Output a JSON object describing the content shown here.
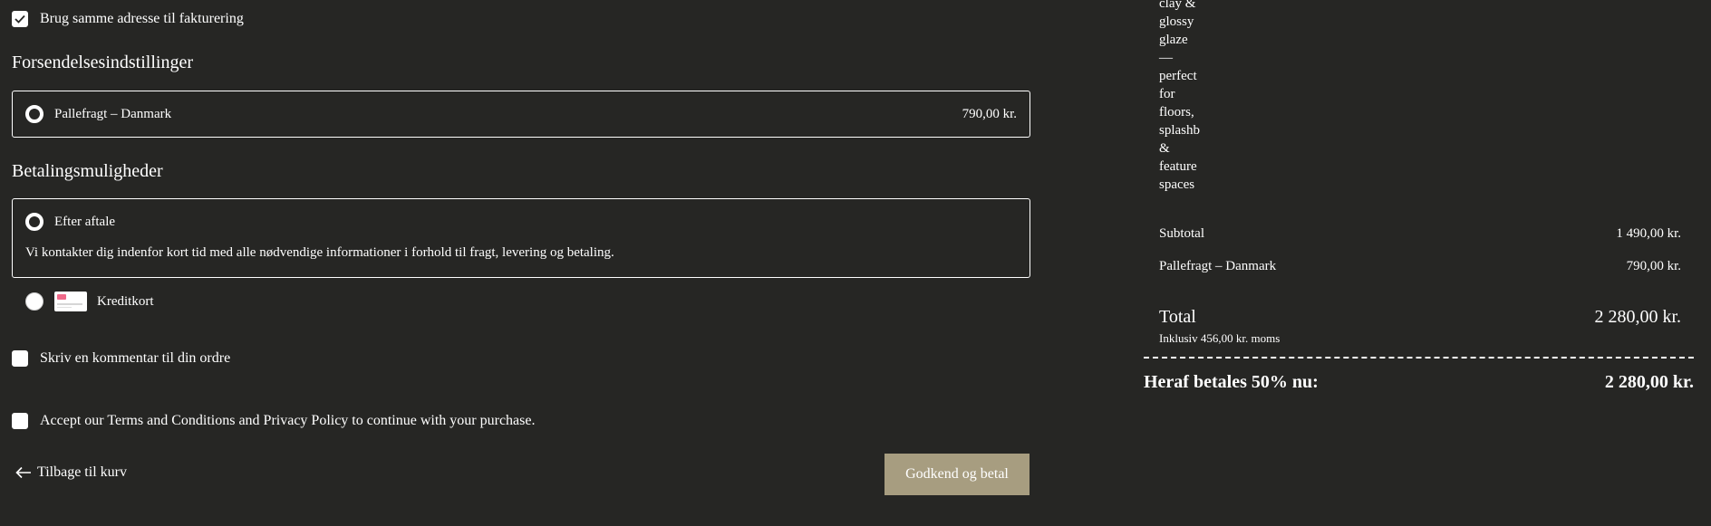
{
  "billing": {
    "same_address_label": "Brug samme adresse til fakturering",
    "same_address_checked": true
  },
  "shipping": {
    "title": "Forsendelsesindstillinger",
    "option_label": "Pallefragt – Danmark",
    "option_price": "790,00 kr."
  },
  "payment": {
    "title": "Betalingsmuligheder",
    "options": [
      {
        "label": "Efter aftale",
        "selected": true,
        "description": "Vi kontakter dig indenfor kort tid med alle nødvendige informationer i forhold til fragt, levering og betaling."
      },
      {
        "label": "Kreditkort",
        "selected": false,
        "icon": "credit-card-icon"
      }
    ]
  },
  "comment": {
    "label": "Skriv en kommentar til din ordre",
    "checked": false
  },
  "terms": {
    "label": "Accept our Terms and Conditions and Privacy Policy to continue with your purchase.",
    "checked": false
  },
  "actions": {
    "back_label": "Tilbage til kurv",
    "pay_label": "Godkend og betal"
  },
  "summary": {
    "product_description_fragment": "clay &\nglossy\nglaze\n—\nperfect\nfor\nfloors,\nsplashb\n&\nfeature\nspaces",
    "subtotal_label": "Subtotal",
    "subtotal_value": "1 490,00 kr.",
    "shipping_label": "Pallefragt – Danmark",
    "shipping_value": "790,00 kr.",
    "total_label": "Total",
    "total_value": "2 280,00 kr.",
    "vat_note": "Inklusiv 456,00 kr. moms",
    "due_now_label": "Heraf betales 50% nu:",
    "due_now_value": "2 280,00 kr."
  },
  "colors": {
    "background": "#262624",
    "text": "#ffffff",
    "button": "#a79d80"
  }
}
